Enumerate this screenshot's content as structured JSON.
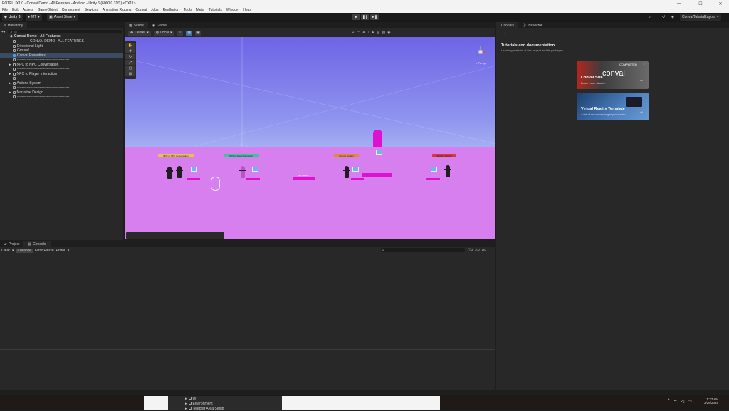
{
  "window": {
    "title": "EOTFLUX1.0 - Convai Demo - All Features - Android - Unity 6 (6000.0.31f1) <DX11>"
  },
  "menu": [
    "File",
    "Edit",
    "Assets",
    "GameObject",
    "Component",
    "Services",
    "Animation Rigging",
    "Convai",
    "Jobs",
    "Reallusion",
    "Tools",
    "Meta",
    "Tutorials",
    "Window",
    "Help"
  ],
  "toolbar": {
    "unity_label": "Unity 6",
    "account_label": "MT",
    "asset_store_label": "Asset Store",
    "layout_label": "ConvaiTutorialLayout"
  },
  "hierarchy": {
    "tab_label": "Hierarchy",
    "search_placeholder": "All",
    "scene_name": "Convai Demo - All Features",
    "items": [
      "---------- CONVAI DEMO - ALL FEATURES --------",
      "Directional Light",
      "Ground",
      "Convai Essentials",
      "--------------------------------------------",
      "NPC to NPC Conversation",
      "--------------------------------------------",
      "NPC to Player Interaction",
      "--------------------------------------------",
      "Actions System",
      "--------------------------------------------",
      "Narrative Design",
      "--------------------------------------------"
    ]
  },
  "scene": {
    "tabs": [
      "Scene",
      "Game"
    ],
    "pivot_label": "Center",
    "space_label": "Local",
    "snap_value": "1",
    "persp_label": "< Persp",
    "signs": [
      "NPC to NPC Conversation",
      "NPC to Player Interaction",
      "Actions System",
      "Narrative Design"
    ],
    "floor_label": "Info Board"
  },
  "console": {
    "tabs": [
      "Project",
      "Console"
    ],
    "clear_label": "Clear",
    "collapse_label": "Collapse",
    "error_pause_label": "Error Pause",
    "editor_label": "Editor",
    "count_errors": "0",
    "count_warnings": "0",
    "count_logs": "0"
  },
  "tutorials": {
    "tabs": [
      "Tutorials",
      "Inspector"
    ],
    "heading": "Tutorials and documentation",
    "subheading": "Learning material of this project and its packages",
    "cards": [
      {
        "title": "Convai SDK",
        "subtitle": "Learn more about...",
        "badge": "COMPLETED",
        "logo": "convai"
      },
      {
        "title": "Virtual Reality Template",
        "subtitle": "A list of resources to get you started"
      }
    ]
  },
  "bottom_tree": [
    "UI",
    "Environment",
    "Teleport Area Setup"
  ],
  "taskbar": {
    "time": "11:27 AM",
    "date": "3/26/2025"
  },
  "colors": {
    "floor": "#d77fef",
    "sky_top": "#6e64e6",
    "accent_blue": "#4fa3e0",
    "magenta": "#e010d0"
  }
}
